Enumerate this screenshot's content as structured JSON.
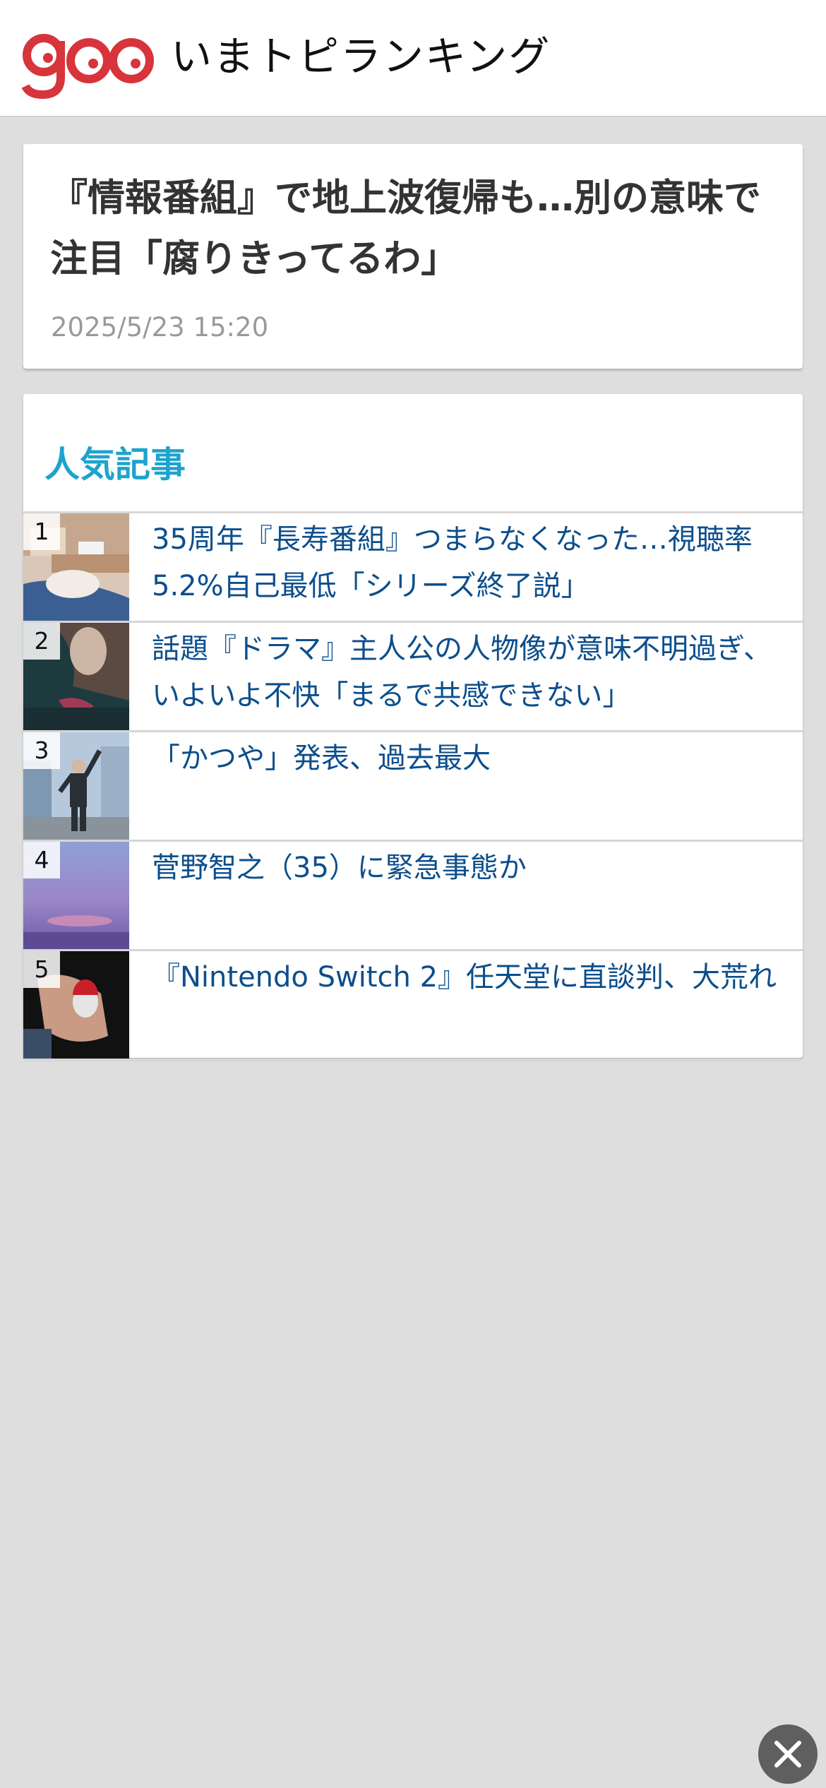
{
  "header": {
    "logo_text": "goo",
    "title": "いまトピランキング"
  },
  "article": {
    "title": "『情報番組』で地上波復帰も…別の意味で注目「腐りきってるわ」",
    "date": "2025/5/23 15:20"
  },
  "ranking": {
    "heading": "人気記事",
    "items": [
      {
        "rank": "1",
        "title": "35周年『長寿番組』つまらなくなった…視聴率5.2%自己最低「シリーズ終了説」"
      },
      {
        "rank": "2",
        "title": "話題『ドラマ』主人公の人物像が意味不明過ぎ、いよいよ不快「まるで共感できない」"
      },
      {
        "rank": "3",
        "title": "「かつや」発表、過去最大"
      },
      {
        "rank": "4",
        "title": "菅野智之（35）に緊急事態か"
      },
      {
        "rank": "5",
        "title": "『Nintendo Switch 2』任天堂に直談判、大荒れ"
      }
    ]
  },
  "colors": {
    "logo": "#d8343b",
    "heading": "#1ea3cc",
    "link": "#0c4e8c",
    "background": "#dedede"
  },
  "icons": {
    "close": "close-icon"
  }
}
